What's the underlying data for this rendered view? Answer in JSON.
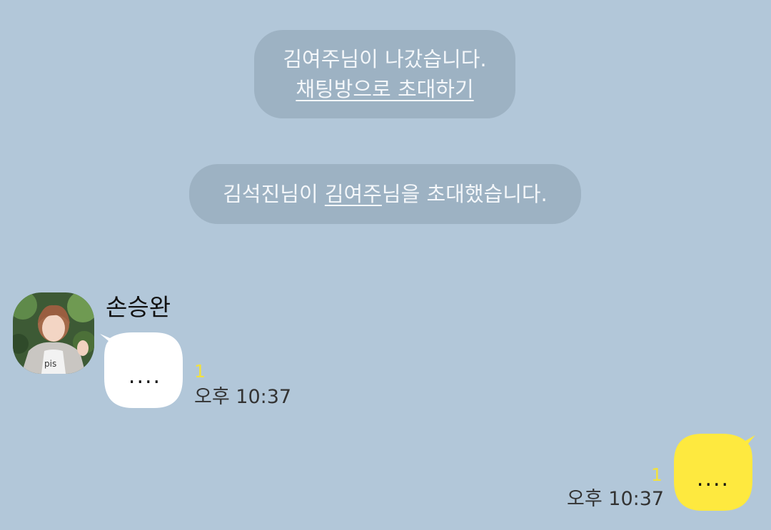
{
  "notices": [
    {
      "line1": "김여주님이 나갔습니다.",
      "invite_link": "채팅방으로 초대하기"
    },
    {
      "inviter": "김석진님이 ",
      "invitee": "김여주",
      "rest": "님을 초대했습니다."
    }
  ],
  "messages": [
    {
      "sender": "손승완",
      "text": "....",
      "unread_count": "1",
      "time": "오후 10:37",
      "direction": "incoming"
    },
    {
      "text": "....",
      "unread_count": "1",
      "time": "오후 10:37",
      "direction": "outgoing"
    }
  ],
  "colors": {
    "background": "#b2c7d9",
    "incoming_bubble": "#ffffff",
    "outgoing_bubble": "#fee93f",
    "unread": "#f4e23a"
  }
}
